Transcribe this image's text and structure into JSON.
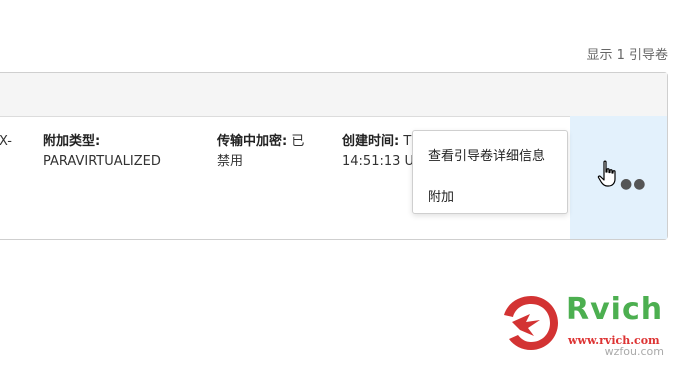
{
  "summary": {
    "count_text": "显示 1 引导卷"
  },
  "row": {
    "prefix_fragment": "X-",
    "attach_type": {
      "label": "附加类型:",
      "value": "PARAVIRTUALIZED"
    },
    "in_transit_encryption": {
      "label": "传输中加密:",
      "value_part1": "已",
      "value_part2": "禁用"
    },
    "created": {
      "label": "创建时间:",
      "value_part1": "T",
      "value_part2": "14:51:13 UT"
    }
  },
  "context_menu": {
    "items": [
      {
        "label": "查看引导卷详细信息"
      },
      {
        "label": "附加"
      }
    ]
  },
  "actions": {
    "more_glyph": "●●"
  },
  "watermark": {
    "brand": "Rvich",
    "url": "www.rvich.com",
    "site": "wzfou.com"
  },
  "colors": {
    "action_bg": "#e3f1fc",
    "brand_green": "#4caf50",
    "brand_red": "#d33333"
  }
}
